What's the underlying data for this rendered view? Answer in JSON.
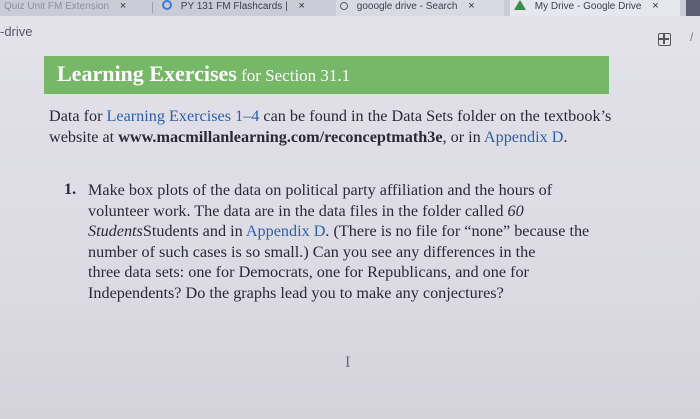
{
  "tabs": [
    {
      "label": "Quiz Unit FM Extension",
      "close": "×"
    },
    {
      "label": "PY 131 FM Flashcards |",
      "close": "×"
    },
    {
      "label": "gooogle drive - Search",
      "close": "×"
    },
    {
      "label": "My Drive - Google Drive",
      "close": "×"
    }
  ],
  "header": {
    "left_label": "-drive"
  },
  "section": {
    "title_bold": "Learning Exercises",
    "title_rest": " for Section 31.1"
  },
  "intro": {
    "part1": "Data for ",
    "link1": "Learning Exercises 1–4",
    "part2": " can be found in the Data Sets folder on the textbook’s website at ",
    "url": "www.macmillanlearning.com/reconceptmath3e",
    "part3": ", or in ",
    "link2": "Appendix D",
    "part4": "."
  },
  "exercise": {
    "number": "1.",
    "lines": [
      "Make box plots of the data on political party affiliation and the hours of",
      "volunteer work. The data are in the data files in the folder called ",
      "Students and in ",
      "number of such cases is so small.) Can you see any differences in the",
      "three data sets: one for Democrats, one for Republicans, and one for",
      "Independents? Do the graphs lead you to make any conjectures?"
    ],
    "folder_italic_1": "60",
    "folder_italic_2": "Students",
    "appendix_link": "Appendix D",
    "line3_rest": ". (There is no file for “none” because the"
  },
  "cursor_glyph": "I",
  "colors": {
    "banner": "#76b867",
    "link": "#2f5fa8",
    "text": "#2a2a35"
  }
}
